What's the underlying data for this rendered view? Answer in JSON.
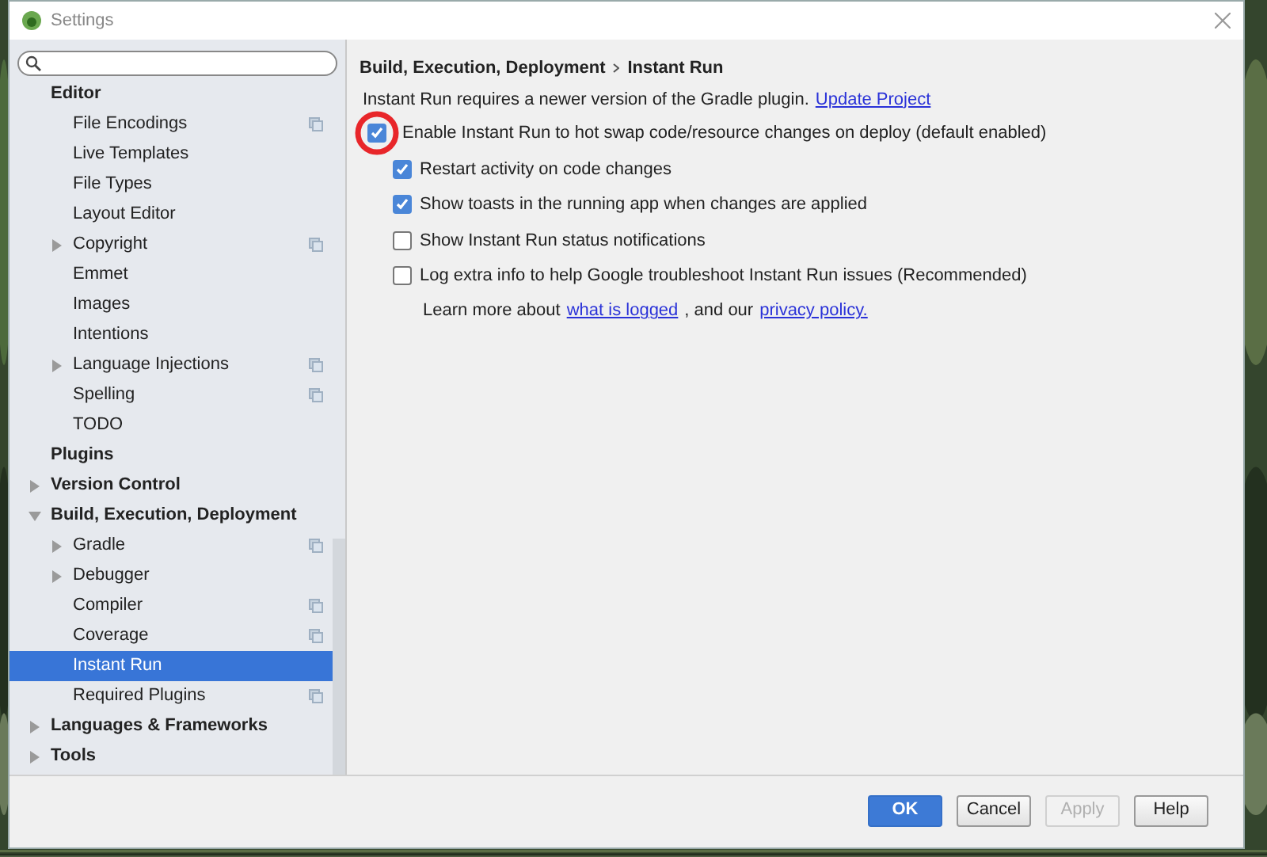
{
  "window": {
    "title": "Settings"
  },
  "sidebar": {
    "items": [
      {
        "label": "Editor",
        "kind": "leaf",
        "selected": false,
        "project_icon": false,
        "children": [
          {
            "label": "File Encodings",
            "kind": "leaf",
            "selected": false,
            "project_icon": true
          },
          {
            "label": "Live Templates",
            "kind": "leaf",
            "selected": false,
            "project_icon": false
          },
          {
            "label": "File Types",
            "kind": "leaf",
            "selected": false,
            "project_icon": false
          },
          {
            "label": "Layout Editor",
            "kind": "leaf",
            "selected": false,
            "project_icon": false
          },
          {
            "label": "Copyright",
            "kind": "collapsed",
            "selected": false,
            "project_icon": true
          },
          {
            "label": "Emmet",
            "kind": "leaf",
            "selected": false,
            "project_icon": false
          },
          {
            "label": "Images",
            "kind": "leaf",
            "selected": false,
            "project_icon": false
          },
          {
            "label": "Intentions",
            "kind": "leaf",
            "selected": false,
            "project_icon": false
          },
          {
            "label": "Language Injections",
            "kind": "collapsed",
            "selected": false,
            "project_icon": true
          },
          {
            "label": "Spelling",
            "kind": "leaf",
            "selected": false,
            "project_icon": true
          },
          {
            "label": "TODO",
            "kind": "leaf",
            "selected": false,
            "project_icon": false
          }
        ]
      },
      {
        "label": "Plugins",
        "kind": "leaf",
        "selected": false,
        "project_icon": false
      },
      {
        "label": "Version Control",
        "kind": "collapsed",
        "selected": false,
        "project_icon": false
      },
      {
        "label": "Build, Execution, Deployment",
        "kind": "expanded",
        "selected": false,
        "project_icon": false,
        "children": [
          {
            "label": "Gradle",
            "kind": "collapsed",
            "selected": false,
            "project_icon": true
          },
          {
            "label": "Debugger",
            "kind": "collapsed",
            "selected": false,
            "project_icon": false
          },
          {
            "label": "Compiler",
            "kind": "leaf",
            "selected": false,
            "project_icon": true
          },
          {
            "label": "Coverage",
            "kind": "leaf",
            "selected": false,
            "project_icon": true
          },
          {
            "label": "Instant Run",
            "kind": "leaf",
            "selected": true,
            "project_icon": false
          },
          {
            "label": "Required Plugins",
            "kind": "leaf",
            "selected": false,
            "project_icon": true
          }
        ]
      },
      {
        "label": "Languages & Frameworks",
        "kind": "collapsed",
        "selected": false,
        "project_icon": false
      },
      {
        "label": "Tools",
        "kind": "collapsed",
        "selected": false,
        "project_icon": false
      }
    ]
  },
  "breadcrumb": [
    "Build, Execution, Deployment",
    "Instant Run"
  ],
  "notice": {
    "text": "Instant Run requires a newer version of the Gradle plugin.",
    "link": "Update Project"
  },
  "options": [
    {
      "label": "Enable Instant Run to hot swap code/resource changes on deploy (default enabled)",
      "checked": true,
      "circled": true,
      "children": [
        {
          "label": "Restart activity on code changes",
          "checked": true,
          "circled": false
        },
        {
          "label": "Show toasts in the running app when changes are applied",
          "checked": true,
          "circled": false
        },
        {
          "label": "Show Instant Run status notifications",
          "checked": false,
          "circled": false
        },
        {
          "label": "Log extra info to help Google troubleshoot Instant Run issues (Recommended)",
          "checked": false,
          "circled": false
        }
      ]
    }
  ],
  "learn_more": {
    "before": "Learn more about",
    "link1": "what is logged",
    "middle": ", and our",
    "link2": "privacy policy."
  },
  "buttons": [
    {
      "label": "OK",
      "kind": "primary",
      "disabled": false
    },
    {
      "label": "Cancel",
      "kind": "normal",
      "disabled": false
    },
    {
      "label": "Apply",
      "kind": "normal",
      "disabled": true
    },
    {
      "label": "Help",
      "kind": "normal",
      "disabled": false
    }
  ]
}
